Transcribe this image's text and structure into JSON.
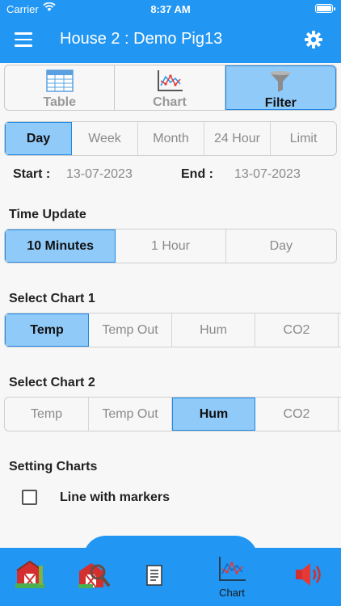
{
  "status_bar": {
    "carrier": "Carrier",
    "time": "8:37 AM"
  },
  "app_bar": {
    "title": "House 2 : Demo Pig13"
  },
  "view_tabs": [
    {
      "label": "Table",
      "icon": "table-icon",
      "active": false
    },
    {
      "label": "Chart",
      "icon": "chart-icon",
      "active": false
    },
    {
      "label": "Filter",
      "icon": "filter-icon",
      "active": true
    }
  ],
  "range_tabs": [
    {
      "label": "Day",
      "active": true
    },
    {
      "label": "Week",
      "active": false
    },
    {
      "label": "Month",
      "active": false
    },
    {
      "label": "24 Hour",
      "active": false
    },
    {
      "label": "Limit",
      "active": false
    }
  ],
  "dates": {
    "start_label": "Start :",
    "start_value": "13-07-2023",
    "end_label": "End :",
    "end_value": "13-07-2023"
  },
  "time_update": {
    "title": "Time Update",
    "options": [
      {
        "label": "10 Minutes",
        "active": true
      },
      {
        "label": "1 Hour",
        "active": false
      },
      {
        "label": "Day",
        "active": false
      }
    ]
  },
  "chart1": {
    "title": "Select Chart 1",
    "options": [
      {
        "label": "Temp",
        "active": true
      },
      {
        "label": "Temp Out",
        "active": false
      },
      {
        "label": "Hum",
        "active": false
      },
      {
        "label": "CO2",
        "active": false
      }
    ]
  },
  "chart2": {
    "title": "Select Chart 2",
    "options": [
      {
        "label": "Temp",
        "active": false
      },
      {
        "label": "Temp Out",
        "active": false
      },
      {
        "label": "Hum",
        "active": true
      },
      {
        "label": "CO2",
        "active": false
      }
    ]
  },
  "settings": {
    "title": "Setting Charts",
    "line_markers_label": "Line with markers",
    "line_markers_checked": false
  },
  "bottom_nav": {
    "items": [
      {
        "icon": "barn-icon"
      },
      {
        "icon": "barn-search-icon"
      },
      {
        "icon": "document-icon"
      },
      {
        "icon": "chart-icon",
        "label": "Chart"
      },
      {
        "icon": "speaker-icon"
      }
    ]
  },
  "colors": {
    "primary": "#2196f3",
    "selected_fill": "#90caf9",
    "selected_border": "#1e88e5"
  }
}
